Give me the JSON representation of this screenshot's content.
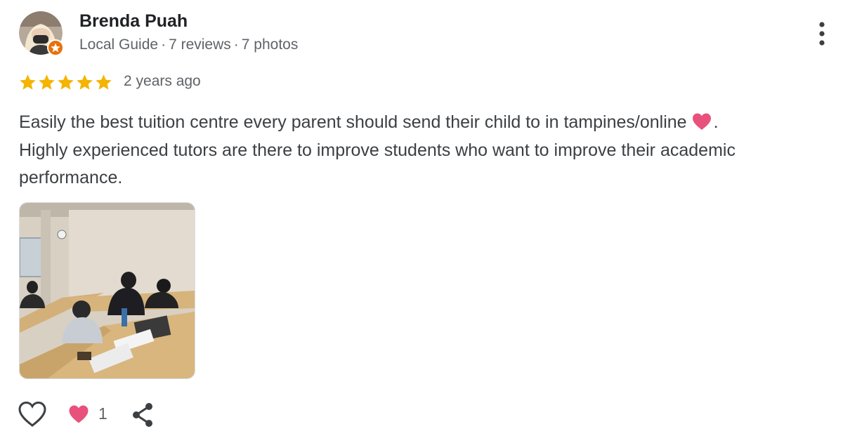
{
  "reviewer": {
    "name": "Brenda Puah",
    "badge": "Local Guide",
    "separator": "·",
    "reviews": "7 reviews",
    "photos": "7 photos"
  },
  "rating": {
    "stars": 5,
    "max_stars": 5,
    "date": "2 years ago"
  },
  "review": {
    "line1": "Easily the best tuition centre every parent should send their child to in tampines/online",
    "after_heart": ".",
    "line2": "Highly experienced tutors are there to improve students who want to improve their academic performance."
  },
  "actions": {
    "reaction_count": "1"
  },
  "icons": {
    "more": "more-vert-icon",
    "star": "star-icon",
    "like": "heart-outline-icon",
    "reaction": "heart-filled-icon",
    "share": "share-icon",
    "badge": "local-guide-badge-icon"
  },
  "colors": {
    "star": "#f4b400",
    "heart": "#e8517c",
    "badge": "#e8710a",
    "name": "#202124",
    "meta": "#5f6368",
    "text": "#3c4043"
  }
}
